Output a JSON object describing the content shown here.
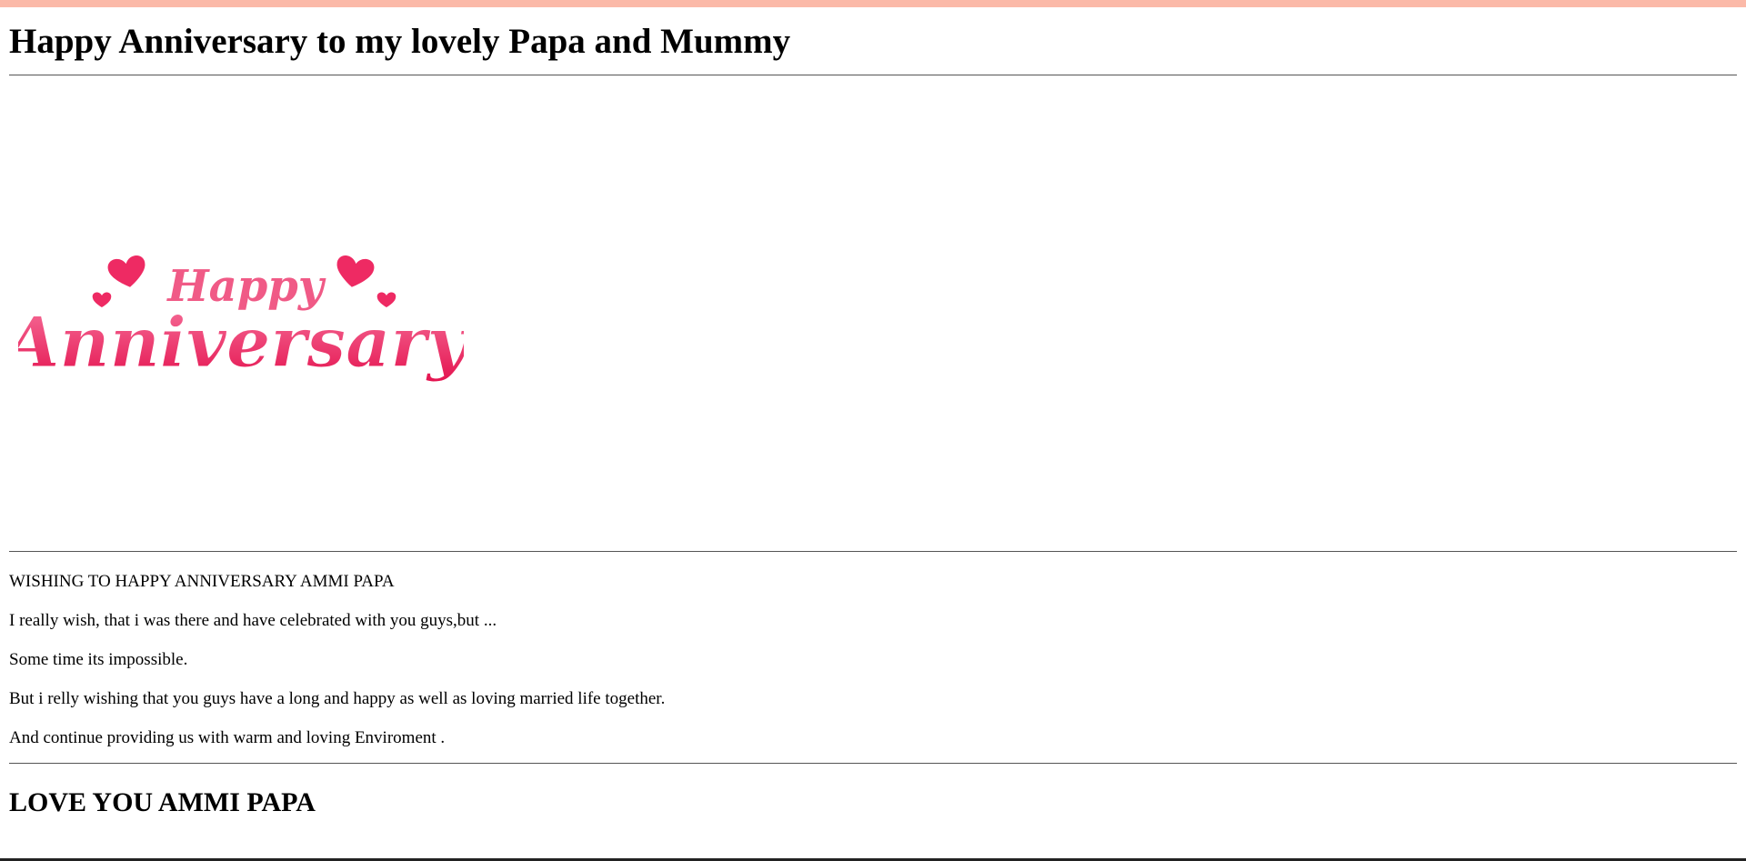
{
  "page": {
    "title": "Happy Anniversary to my lovely Papa and Mummy",
    "banner_image": {
      "icon": "anniversary-banner-image",
      "line1": "Happy",
      "line2": "Anniversary",
      "colors": {
        "accent": "#ee2a63",
        "light": "#f6709a"
      }
    },
    "message_lines": [
      "WISHING TO HAPPY ANNIVERSARY AMMI PAPA",
      "I really wish, that i was there and have celebrated with you guys,but ...",
      "Some time its impossible.",
      "But i relly wishing that you guys have a long and happy as well as loving married life together.",
      "And continue providing us with warm and loving Enviroment ."
    ],
    "closing": "LOVE YOU AMMI PAPA"
  },
  "colors": {
    "top_strip": "#fbb9a8",
    "divider": "#555555",
    "background": "#ffffff"
  }
}
